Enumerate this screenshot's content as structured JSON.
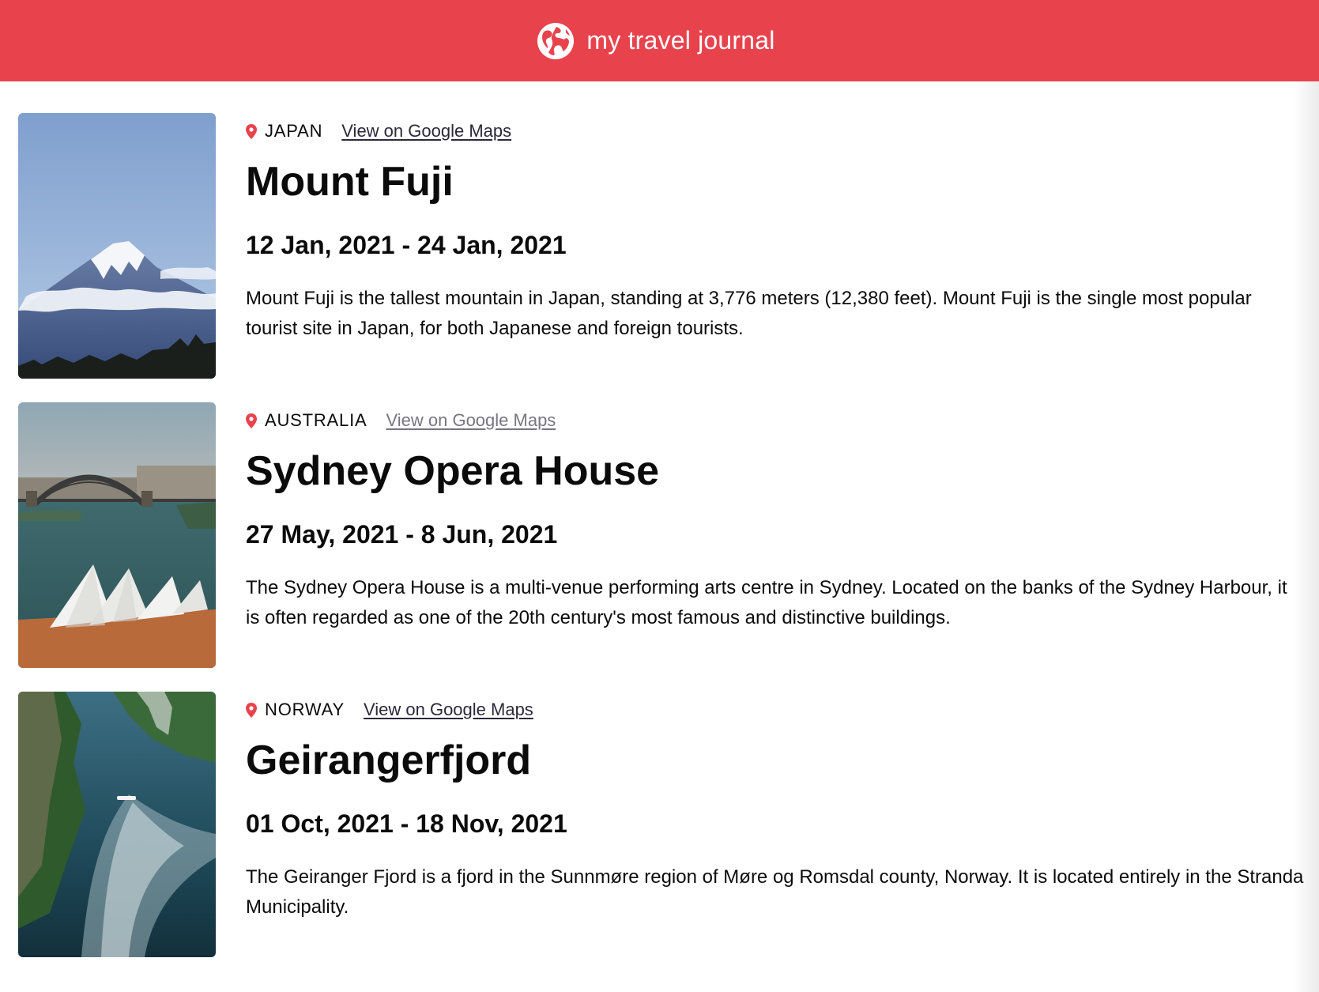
{
  "header": {
    "title": "my travel journal",
    "icon": "globe-icon",
    "background": "#e8434d"
  },
  "entries": [
    {
      "image": "mount-fuji-photo",
      "country": "JAPAN",
      "maps_link": "View on Google Maps",
      "title": "Mount Fuji",
      "dates": "12 Jan, 2021 - 24 Jan, 2021",
      "description": "Mount Fuji is the tallest mountain in Japan, standing at 3,776 meters (12,380 feet). Mount Fuji is the single most popular tourist site in Japan, for both Japanese and foreign tourists."
    },
    {
      "image": "sydney-opera-house-photo",
      "country": "AUSTRALIA",
      "maps_link": "View on Google Maps",
      "title": "Sydney Opera House",
      "dates": "27 May, 2021 - 8 Jun, 2021",
      "description": "The Sydney Opera House is a multi-venue performing arts centre in Sydney. Located on the banks of the Sydney Harbour, it is often regarded as one of the 20th century's most famous and distinctive buildings."
    },
    {
      "image": "geirangerfjord-photo",
      "country": "NORWAY",
      "maps_link": "View on Google Maps",
      "title": "Geirangerfjord",
      "dates": "01 Oct, 2021 - 18 Nov, 2021",
      "description": "The Geiranger Fjord is a fjord in the Sunnmøre region of Møre og Romsdal county, Norway. It is located entirely in the Stranda Municipality."
    }
  ],
  "colors": {
    "accent": "#e8434d",
    "link": "#2b283a",
    "link_visited": "#777582"
  }
}
